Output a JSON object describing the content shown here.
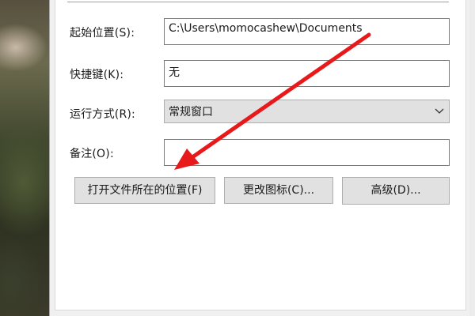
{
  "form": {
    "start_in_label": "起始位置(S):",
    "start_in_value": "C:\\Users\\momocashew\\Documents",
    "shortcut_key_label": "快捷键(K):",
    "shortcut_key_value": "无",
    "run_label": "运行方式(R):",
    "run_value": "常规窗口",
    "comment_label": "备注(O):",
    "comment_value": ""
  },
  "buttons": {
    "open_file_location": "打开文件所在的位置(F)",
    "change_icon": "更改图标(C)...",
    "advanced": "高级(D)..."
  },
  "annotation": {
    "arrow_color": "#e8191b"
  },
  "icons": {
    "dropdown": "chevron-down-icon",
    "annotation": "red-arrow-icon"
  }
}
